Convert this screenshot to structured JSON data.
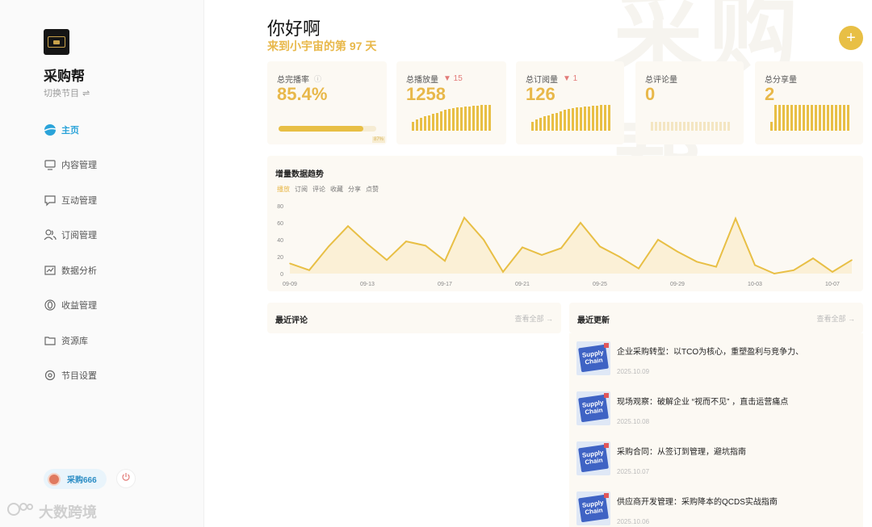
{
  "sidebar": {
    "app_name": "采购帮",
    "switch_label": "切换节目",
    "switch_icon": "⇌",
    "nav": [
      {
        "label": "主页",
        "icon": "globe-icon",
        "active": true
      },
      {
        "label": "内容管理",
        "icon": "monitor-icon"
      },
      {
        "label": "互动管理",
        "icon": "chat-icon"
      },
      {
        "label": "订阅管理",
        "icon": "users-icon"
      },
      {
        "label": "数据分析",
        "icon": "chart-icon"
      },
      {
        "label": "收益管理",
        "icon": "coin-icon"
      },
      {
        "label": "资源库",
        "icon": "folder-icon"
      },
      {
        "label": "节目设置",
        "icon": "gear-icon"
      }
    ],
    "user_name": "采购666",
    "watermark": "大数跨境"
  },
  "header": {
    "greeting": "你好啊",
    "subtitle": "来到小宇宙的第 97 天",
    "background_text": "采购帮",
    "fab_label": "+"
  },
  "stats": [
    {
      "label": "总完播率",
      "value": "85.4%",
      "info": "ⓘ",
      "progress": 0.87,
      "tag": "87%"
    },
    {
      "label": "总播放量",
      "value": "1258",
      "delta": "▼ 15",
      "bars": [
        0.35,
        0.45,
        0.5,
        0.55,
        0.6,
        0.65,
        0.7,
        0.75,
        0.8,
        0.85,
        0.88,
        0.9,
        0.92,
        0.94,
        0.95,
        0.97,
        0.98,
        1,
        1,
        1
      ]
    },
    {
      "label": "总订阅量",
      "value": "126",
      "delta": "▼ 1",
      "bars": [
        0.35,
        0.45,
        0.5,
        0.55,
        0.6,
        0.65,
        0.7,
        0.75,
        0.8,
        0.85,
        0.88,
        0.9,
        0.92,
        0.94,
        0.95,
        0.97,
        0.98,
        1,
        1,
        1
      ]
    },
    {
      "label": "总评论量",
      "value": "0",
      "bars": [
        0.35,
        0.35,
        0.35,
        0.35,
        0.35,
        0.35,
        0.35,
        0.35,
        0.35,
        0.35,
        0.35,
        0.35,
        0.35,
        0.35,
        0.35,
        0.35,
        0.35,
        0.35,
        0.35,
        0.35
      ],
      "pale": true
    },
    {
      "label": "总分享量",
      "value": "2",
      "bars": [
        0.35,
        1,
        1,
        1,
        1,
        1,
        1,
        1,
        1,
        1,
        1,
        1,
        1,
        1,
        1,
        1,
        1,
        1,
        1,
        1
      ]
    }
  ],
  "trend": {
    "title": "增量数据趋势",
    "tabs": [
      "播放",
      "订阅",
      "评论",
      "收藏",
      "分享",
      "点赞"
    ]
  },
  "chart_data": {
    "type": "area",
    "x": [
      "09-08",
      "09-09",
      "09-10",
      "09-11",
      "09-12",
      "09-13",
      "09-14",
      "09-15",
      "09-16",
      "09-17",
      "09-18",
      "09-19",
      "09-20",
      "09-21",
      "09-22",
      "09-23",
      "09-24",
      "09-25",
      "09-26",
      "09-27",
      "09-28",
      "09-29",
      "09-30",
      "10-01",
      "10-02",
      "10-03",
      "10-04",
      "10-05",
      "10-06",
      "10-07",
      "10-08",
      "10-09"
    ],
    "x_ticks": [
      "09-09",
      "09-13",
      "09-17",
      "09-21",
      "09-25",
      "09-29",
      "10-03",
      "10-07"
    ],
    "values": [
      12,
      4,
      32,
      56,
      35,
      16,
      38,
      33,
      15,
      66,
      40,
      2,
      31,
      22,
      30,
      60,
      32,
      20,
      6,
      40,
      26,
      14,
      8,
      65,
      10,
      0,
      4,
      18,
      2,
      16
    ],
    "ylim": [
      0,
      80
    ],
    "yticks": [
      0,
      20,
      40,
      60,
      80
    ],
    "color": "#e8bf45",
    "fill": "#fbf0d6"
  },
  "comments": {
    "title": "最近评论",
    "view_all": "查看全部 →"
  },
  "updates": {
    "title": "最近更新",
    "view_all": "查看全部 →",
    "thumb_text": "Supply Chain",
    "items": [
      {
        "title": "企业采购转型：以TCO为核心，重塑盈利与竞争力、",
        "date": "2025.10.09"
      },
      {
        "title": "现场观察：破解企业 “视而不见” ，直击运营痛点",
        "date": "2025.10.08"
      },
      {
        "title": "采购合同：从签订到管理，避坑指南",
        "date": "2025.10.07"
      },
      {
        "title": "供应商开发管理：采购降本的QCDS实战指南",
        "date": "2025.10.06"
      }
    ]
  },
  "colors": {
    "accent": "#e8bf45",
    "active_nav": "#2aa3d9",
    "delta": "#e27b78"
  }
}
